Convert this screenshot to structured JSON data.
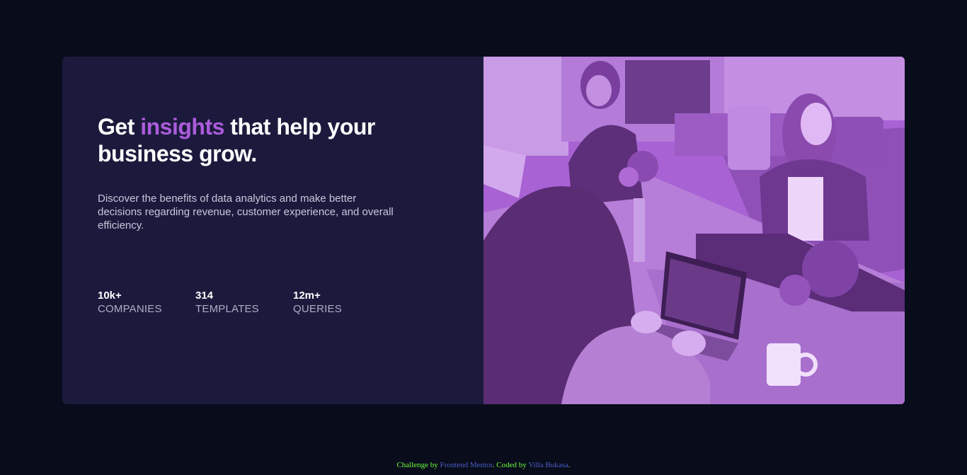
{
  "card": {
    "headline_pre": "Get ",
    "headline_accent": "insights",
    "headline_post": " that help your business grow.",
    "description": "Discover the benefits of data analytics and make better decisions regarding revenue, customer experience, and overall efficiency.",
    "stats": [
      {
        "value": "10k+",
        "label": "Companies"
      },
      {
        "value": "314",
        "label": "Templates"
      },
      {
        "value": "12m+",
        "label": "Queries"
      }
    ],
    "image_alt": "Colleagues working together at a shared office table with laptops"
  },
  "attribution": {
    "challenge_by": "Challenge by ",
    "frontend_mentor": "Frontend Mentor",
    "coded_by": ". Coded by ",
    "author": "Villa Bukasa",
    "end": "."
  },
  "colors": {
    "page_bg": "#090c1b",
    "card_bg": "#1c1a3c",
    "accent": "#aa5cdb",
    "image_overlay": "#a35fd0"
  }
}
